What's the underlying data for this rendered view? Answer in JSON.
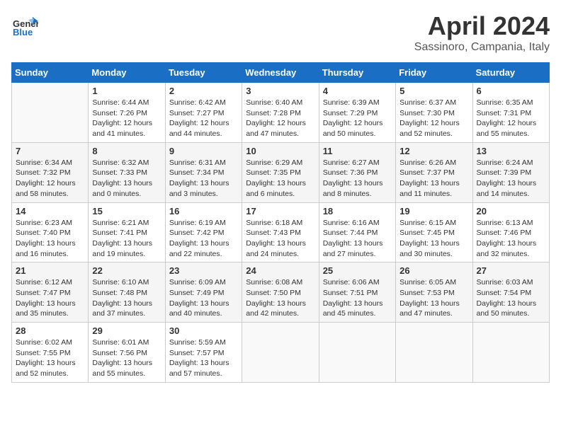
{
  "header": {
    "logo_general": "General",
    "logo_blue": "Blue",
    "title": "April 2024",
    "location": "Sassinoro, Campania, Italy"
  },
  "days_of_week": [
    "Sunday",
    "Monday",
    "Tuesday",
    "Wednesday",
    "Thursday",
    "Friday",
    "Saturday"
  ],
  "weeks": [
    [
      {
        "day": "",
        "info": ""
      },
      {
        "day": "1",
        "info": "Sunrise: 6:44 AM\nSunset: 7:26 PM\nDaylight: 12 hours\nand 41 minutes."
      },
      {
        "day": "2",
        "info": "Sunrise: 6:42 AM\nSunset: 7:27 PM\nDaylight: 12 hours\nand 44 minutes."
      },
      {
        "day": "3",
        "info": "Sunrise: 6:40 AM\nSunset: 7:28 PM\nDaylight: 12 hours\nand 47 minutes."
      },
      {
        "day": "4",
        "info": "Sunrise: 6:39 AM\nSunset: 7:29 PM\nDaylight: 12 hours\nand 50 minutes."
      },
      {
        "day": "5",
        "info": "Sunrise: 6:37 AM\nSunset: 7:30 PM\nDaylight: 12 hours\nand 52 minutes."
      },
      {
        "day": "6",
        "info": "Sunrise: 6:35 AM\nSunset: 7:31 PM\nDaylight: 12 hours\nand 55 minutes."
      }
    ],
    [
      {
        "day": "7",
        "info": "Sunrise: 6:34 AM\nSunset: 7:32 PM\nDaylight: 12 hours\nand 58 minutes."
      },
      {
        "day": "8",
        "info": "Sunrise: 6:32 AM\nSunset: 7:33 PM\nDaylight: 13 hours\nand 0 minutes."
      },
      {
        "day": "9",
        "info": "Sunrise: 6:31 AM\nSunset: 7:34 PM\nDaylight: 13 hours\nand 3 minutes."
      },
      {
        "day": "10",
        "info": "Sunrise: 6:29 AM\nSunset: 7:35 PM\nDaylight: 13 hours\nand 6 minutes."
      },
      {
        "day": "11",
        "info": "Sunrise: 6:27 AM\nSunset: 7:36 PM\nDaylight: 13 hours\nand 8 minutes."
      },
      {
        "day": "12",
        "info": "Sunrise: 6:26 AM\nSunset: 7:37 PM\nDaylight: 13 hours\nand 11 minutes."
      },
      {
        "day": "13",
        "info": "Sunrise: 6:24 AM\nSunset: 7:39 PM\nDaylight: 13 hours\nand 14 minutes."
      }
    ],
    [
      {
        "day": "14",
        "info": "Sunrise: 6:23 AM\nSunset: 7:40 PM\nDaylight: 13 hours\nand 16 minutes."
      },
      {
        "day": "15",
        "info": "Sunrise: 6:21 AM\nSunset: 7:41 PM\nDaylight: 13 hours\nand 19 minutes."
      },
      {
        "day": "16",
        "info": "Sunrise: 6:19 AM\nSunset: 7:42 PM\nDaylight: 13 hours\nand 22 minutes."
      },
      {
        "day": "17",
        "info": "Sunrise: 6:18 AM\nSunset: 7:43 PM\nDaylight: 13 hours\nand 24 minutes."
      },
      {
        "day": "18",
        "info": "Sunrise: 6:16 AM\nSunset: 7:44 PM\nDaylight: 13 hours\nand 27 minutes."
      },
      {
        "day": "19",
        "info": "Sunrise: 6:15 AM\nSunset: 7:45 PM\nDaylight: 13 hours\nand 30 minutes."
      },
      {
        "day": "20",
        "info": "Sunrise: 6:13 AM\nSunset: 7:46 PM\nDaylight: 13 hours\nand 32 minutes."
      }
    ],
    [
      {
        "day": "21",
        "info": "Sunrise: 6:12 AM\nSunset: 7:47 PM\nDaylight: 13 hours\nand 35 minutes."
      },
      {
        "day": "22",
        "info": "Sunrise: 6:10 AM\nSunset: 7:48 PM\nDaylight: 13 hours\nand 37 minutes."
      },
      {
        "day": "23",
        "info": "Sunrise: 6:09 AM\nSunset: 7:49 PM\nDaylight: 13 hours\nand 40 minutes."
      },
      {
        "day": "24",
        "info": "Sunrise: 6:08 AM\nSunset: 7:50 PM\nDaylight: 13 hours\nand 42 minutes."
      },
      {
        "day": "25",
        "info": "Sunrise: 6:06 AM\nSunset: 7:51 PM\nDaylight: 13 hours\nand 45 minutes."
      },
      {
        "day": "26",
        "info": "Sunrise: 6:05 AM\nSunset: 7:53 PM\nDaylight: 13 hours\nand 47 minutes."
      },
      {
        "day": "27",
        "info": "Sunrise: 6:03 AM\nSunset: 7:54 PM\nDaylight: 13 hours\nand 50 minutes."
      }
    ],
    [
      {
        "day": "28",
        "info": "Sunrise: 6:02 AM\nSunset: 7:55 PM\nDaylight: 13 hours\nand 52 minutes."
      },
      {
        "day": "29",
        "info": "Sunrise: 6:01 AM\nSunset: 7:56 PM\nDaylight: 13 hours\nand 55 minutes."
      },
      {
        "day": "30",
        "info": "Sunrise: 5:59 AM\nSunset: 7:57 PM\nDaylight: 13 hours\nand 57 minutes."
      },
      {
        "day": "",
        "info": ""
      },
      {
        "day": "",
        "info": ""
      },
      {
        "day": "",
        "info": ""
      },
      {
        "day": "",
        "info": ""
      }
    ]
  ]
}
